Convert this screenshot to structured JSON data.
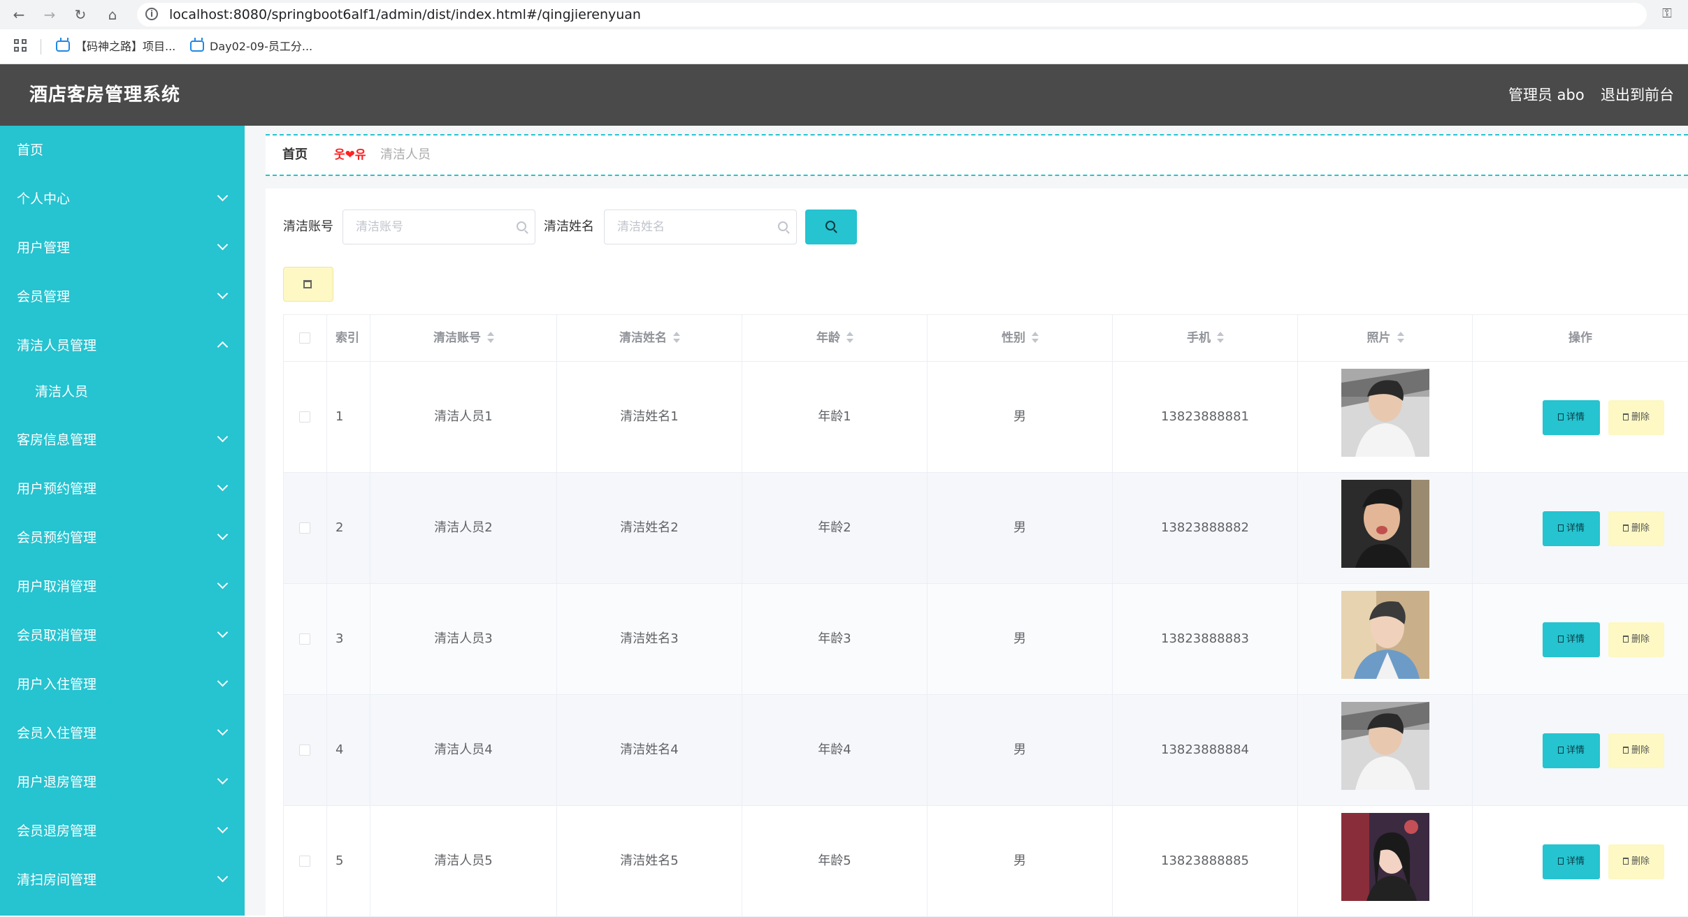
{
  "browser": {
    "url": "localhost:8080/springboot6alf1/admin/dist/index.html#/qingjierenyuan",
    "bookmarks": [
      "【码神之路】项目...",
      "Day02-09-员工分..."
    ]
  },
  "header": {
    "title": "酒店客房管理系统",
    "admin": "管理员 abo",
    "exit": "退出到前台"
  },
  "sidebar": {
    "items": [
      {
        "label": "首页"
      },
      {
        "label": "个人中心"
      },
      {
        "label": "用户管理"
      },
      {
        "label": "会员管理"
      },
      {
        "label": "清洁人员管理"
      },
      {
        "label": "清洁人员"
      },
      {
        "label": "客房信息管理"
      },
      {
        "label": "用户预约管理"
      },
      {
        "label": "会员预约管理"
      },
      {
        "label": "用户取消管理"
      },
      {
        "label": "会员取消管理"
      },
      {
        "label": "用户入住管理"
      },
      {
        "label": "会员入住管理"
      },
      {
        "label": "用户退房管理"
      },
      {
        "label": "会员退房管理"
      },
      {
        "label": "清扫房间管理"
      }
    ]
  },
  "breadcrumb": {
    "home": "首页",
    "separator": "웃❤유",
    "current": "清洁人员"
  },
  "search": {
    "account_label": "清洁账号",
    "account_placeholder": "清洁账号",
    "name_label": "清洁姓名",
    "name_placeholder": "清洁姓名"
  },
  "table": {
    "headers": {
      "index": "索引",
      "account": "清洁账号",
      "name": "清洁姓名",
      "age": "年龄",
      "gender": "性别",
      "phone": "手机",
      "photo": "照片",
      "actions": "操作"
    },
    "detail_label": "详情",
    "delete_label": "删除",
    "rows": [
      {
        "index": "1",
        "account": "清洁人员1",
        "name": "清洁姓名1",
        "age": "年龄1",
        "gender": "男",
        "phone": "13823888881"
      },
      {
        "index": "2",
        "account": "清洁人员2",
        "name": "清洁姓名2",
        "age": "年龄2",
        "gender": "男",
        "phone": "13823888882"
      },
      {
        "index": "3",
        "account": "清洁人员3",
        "name": "清洁姓名3",
        "age": "年龄3",
        "gender": "男",
        "phone": "13823888883"
      },
      {
        "index": "4",
        "account": "清洁人员4",
        "name": "清洁姓名4",
        "age": "年龄4",
        "gender": "男",
        "phone": "13823888884"
      },
      {
        "index": "5",
        "account": "清洁人员5",
        "name": "清洁姓名5",
        "age": "年龄5",
        "gender": "男",
        "phone": "13823888885"
      }
    ]
  },
  "colors": {
    "accent": "#26c3d0",
    "header_bg": "#4a4a4a",
    "delete_bg": "#fdf8c4"
  }
}
